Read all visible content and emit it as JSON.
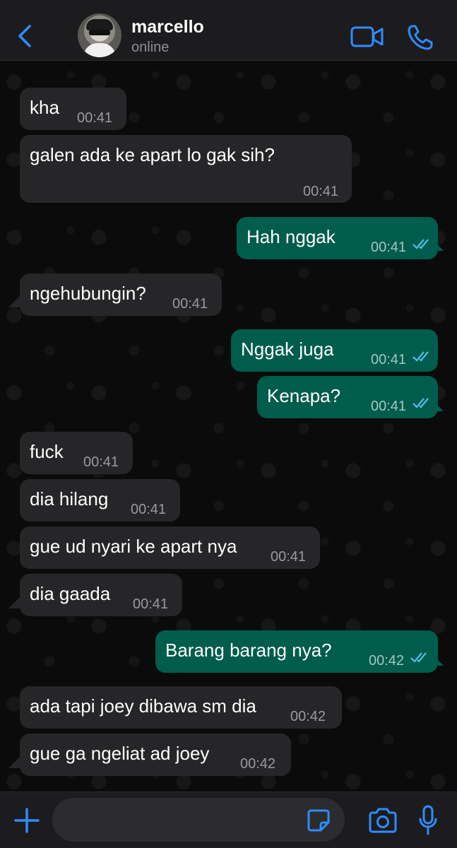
{
  "header": {
    "contact_name": "marcello",
    "status": "online"
  },
  "composer": {
    "placeholder": ""
  },
  "colors": {
    "incoming_bubble": "#262628",
    "outgoing_bubble": "#005c4b",
    "accent": "#2f8cff"
  },
  "messages": [
    {
      "dir": "in",
      "text": "kha",
      "time": "00:41"
    },
    {
      "dir": "in",
      "text": "galen ada ke apart lo gak sih?",
      "time": "00:41"
    },
    {
      "dir": "out",
      "text": "Hah nggak",
      "time": "00:41",
      "read": true
    },
    {
      "dir": "in",
      "text": "ngehubungin?",
      "time": "00:41"
    },
    {
      "dir": "out",
      "text": "Nggak juga",
      "time": "00:41",
      "read": true
    },
    {
      "dir": "out",
      "text": "Kenapa?",
      "time": "00:41",
      "read": true
    },
    {
      "dir": "in",
      "text": "fuck",
      "time": "00:41"
    },
    {
      "dir": "in",
      "text": "dia hilang",
      "time": "00:41"
    },
    {
      "dir": "in",
      "text": "gue ud nyari ke apart nya",
      "time": "00:41"
    },
    {
      "dir": "in",
      "text": "dia gaada",
      "time": "00:41"
    },
    {
      "dir": "out",
      "text": "Barang barang nya?",
      "time": "00:42",
      "read": true
    },
    {
      "dir": "in",
      "text": "ada tapi joey dibawa sm dia",
      "time": "00:42"
    },
    {
      "dir": "in",
      "text": "gue ga ngeliat ad joey",
      "time": "00:42"
    }
  ]
}
